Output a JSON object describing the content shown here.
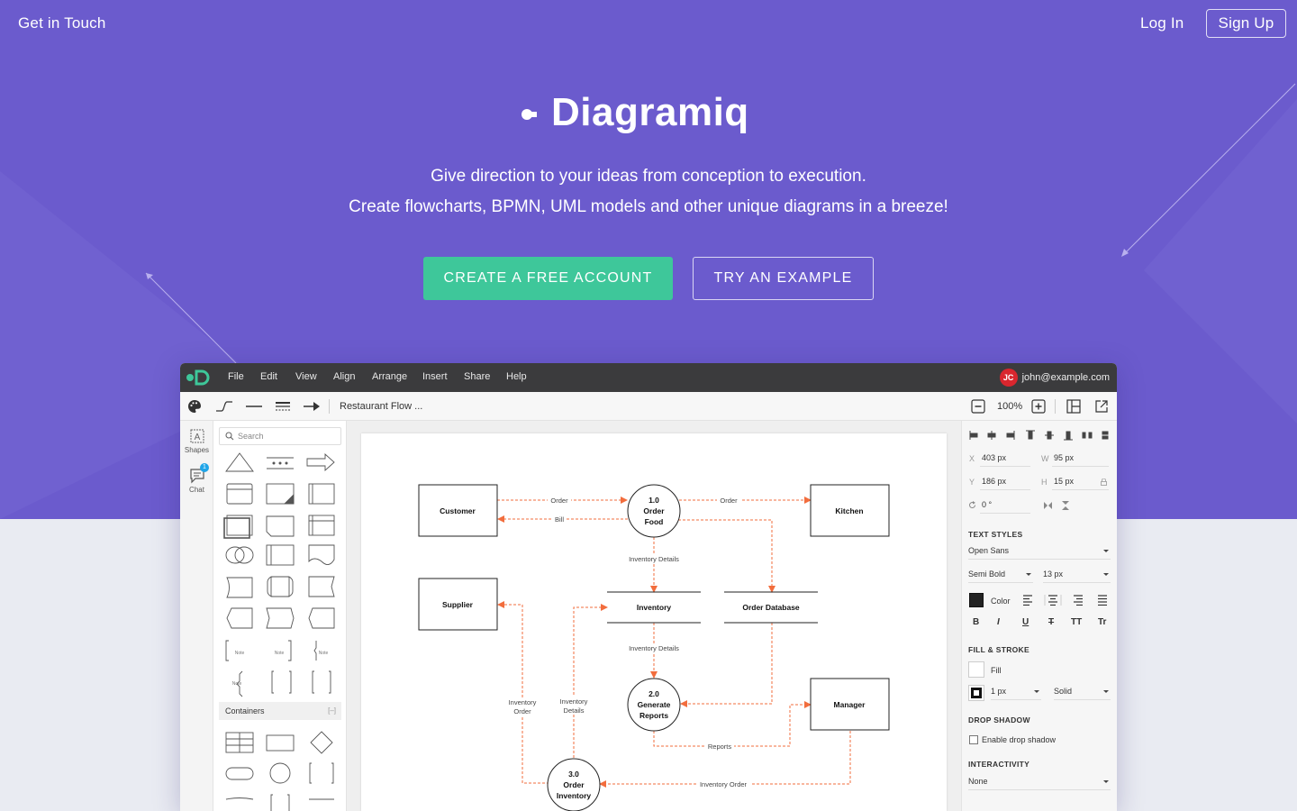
{
  "nav": {
    "get_in_touch": "Get in Touch",
    "login": "Log In",
    "signup": "Sign Up"
  },
  "brand": {
    "name": "Diagramiq"
  },
  "hero": {
    "tagline_1": "Give direction to your ideas from conception to execution.",
    "tagline_2": "Create flowcharts, BPMN, UML models and other unique diagrams in a breeze!",
    "cta_create": "CREATE A FREE ACCOUNT",
    "cta_try": "TRY AN EXAMPLE"
  },
  "app": {
    "menu": [
      "File",
      "Edit",
      "View",
      "Align",
      "Arrange",
      "Insert",
      "Share",
      "Help"
    ],
    "user": {
      "initials": "JC",
      "email": "john@example.com"
    },
    "document_title": "Restaurant Flow ...",
    "zoom": "100%",
    "rail": {
      "shapes": "Shapes",
      "chat": "Chat",
      "chat_badge": "1"
    },
    "search_placeholder": "Search",
    "containers_label": "Containers",
    "containers_toggle": "[–]",
    "note_label": "Note",
    "props": {
      "x_label": "X",
      "x": "403 px",
      "w_label": "W",
      "w": "95 px",
      "y_label": "Y",
      "y": "186 px",
      "h_label": "H",
      "h": "15 px",
      "rotation": "0 °",
      "text_styles": "TEXT STYLES",
      "font": "Open Sans",
      "weight": "Semi Bold",
      "size": "13 px",
      "color_label": "Color",
      "bold": "B",
      "italic": "I",
      "underline": "U",
      "strike": "T",
      "upper": "TT",
      "caps": "Tr",
      "fill_stroke": "FILL & STROKE",
      "fill_label": "Fill",
      "stroke_width": "1 px",
      "stroke_style": "Solid",
      "drop_shadow": "DROP SHADOW",
      "enable_shadow": "Enable drop shadow",
      "interactivity": "INTERACTIVITY",
      "interactivity_value": "None"
    },
    "diagram": {
      "customer": "Customer",
      "kitchen": "Kitchen",
      "supplier": "Supplier",
      "manager": "Manager",
      "p1": [
        "1.0",
        "Order",
        "Food"
      ],
      "p2": [
        "2.0",
        "Generate",
        "Reports"
      ],
      "p3": [
        "3.0",
        "Order",
        "Inventory"
      ],
      "inventory": "Inventory",
      "order_db": "Order Database",
      "order_1": "Order",
      "bill": "Bill",
      "order_2": "Order",
      "inv_details_1": "Inventory Details",
      "inv_details_2": "Inventory Details",
      "inv_order_1": [
        "Inventory",
        "Order"
      ],
      "inv_details_3": [
        "Inventory",
        "Details"
      ],
      "reports": "Reports",
      "inv_order_2": "Inventory Order"
    }
  },
  "colors": {
    "hero_bg": "#6b5bcd",
    "page_bg": "#e9ebf2",
    "cta_green": "#3ec79a",
    "menubar": "#3b3b3d",
    "arrow": "#f26d3d",
    "avatar": "#d9262e"
  }
}
